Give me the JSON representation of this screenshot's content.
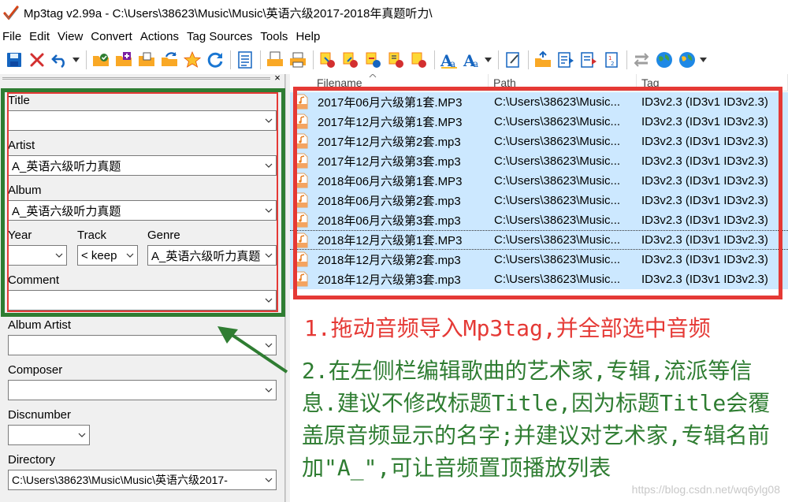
{
  "window": {
    "title": "Mp3tag v2.99a  -  C:\\Users\\38623\\Music\\Music\\英语六级2017-2018年真题听力\\"
  },
  "menu": [
    "File",
    "Edit",
    "View",
    "Convert",
    "Actions",
    "Tag Sources",
    "Tools",
    "Help"
  ],
  "toolbar": {
    "icons": [
      "save-icon",
      "remove-tag-icon",
      "undo-icon",
      "change-directory-icon",
      "add-directory-icon",
      "open-folder-icon",
      "refresh-folder-icon",
      "favorite-star-icon",
      "reload-icon",
      "extended-tags-icon",
      "export-icon",
      "print-icon",
      "tag-to-filename-icon",
      "filename-to-tag-icon",
      "tag-to-tag-icon",
      "text-file-to-tag-icon",
      "tag-from-list-icon",
      "case-conversion-icon",
      "text-format-icon",
      "edit-icon",
      "import-icon",
      "playlist-icon",
      "playlist-alt-icon",
      "numbering-icon",
      "web-source-icon",
      "globe-icon",
      "globe-alt-icon"
    ],
    "colors": {
      "blue": "#1565c0",
      "yellow": "#f9a825",
      "red": "#d32f2f",
      "green": "#2e7d32"
    }
  },
  "left_panel": {
    "fields": {
      "title": {
        "label": "Title",
        "value": ""
      },
      "artist": {
        "label": "Artist",
        "value": "A_英语六级听力真题"
      },
      "album": {
        "label": "Album",
        "value": "A_英语六级听力真题"
      },
      "year": {
        "label": "Year",
        "value": ""
      },
      "track": {
        "label": "Track",
        "value": "< keep"
      },
      "genre": {
        "label": "Genre",
        "value": "A_英语六级听力真题"
      },
      "comment": {
        "label": "Comment",
        "value": ""
      },
      "album_artist": {
        "label": "Album Artist",
        "value": ""
      },
      "composer": {
        "label": "Composer",
        "value": ""
      },
      "discnumber": {
        "label": "Discnumber",
        "value": ""
      },
      "directory": {
        "label": "Directory",
        "value": "C:\\Users\\38623\\Music\\Music\\英语六级2017-"
      }
    },
    "highlight_colors": {
      "green": "#2f7d32",
      "red": "#e53935"
    }
  },
  "file_list": {
    "columns": [
      "Filename",
      "Path",
      "Tag"
    ],
    "rows": [
      {
        "filename": "2017年06月六级第1套.MP3",
        "path": "C:\\Users\\38623\\Music...",
        "tag": "ID3v2.3 (ID3v1 ID3v2.3)"
      },
      {
        "filename": "2017年12月六级第1套.MP3",
        "path": "C:\\Users\\38623\\Music...",
        "tag": "ID3v2.3 (ID3v1 ID3v2.3)"
      },
      {
        "filename": "2017年12月六级第2套.mp3",
        "path": "C:\\Users\\38623\\Music...",
        "tag": "ID3v2.3 (ID3v1 ID3v2.3)"
      },
      {
        "filename": "2017年12月六级第3套.mp3",
        "path": "C:\\Users\\38623\\Music...",
        "tag": "ID3v2.3 (ID3v1 ID3v2.3)"
      },
      {
        "filename": "2018年06月六级第1套.MP3",
        "path": "C:\\Users\\38623\\Music...",
        "tag": "ID3v2.3 (ID3v1 ID3v2.3)"
      },
      {
        "filename": "2018年06月六级第2套.mp3",
        "path": "C:\\Users\\38623\\Music...",
        "tag": "ID3v2.3 (ID3v1 ID3v2.3)"
      },
      {
        "filename": "2018年06月六级第3套.mp3",
        "path": "C:\\Users\\38623\\Music...",
        "tag": "ID3v2.3 (ID3v1 ID3v2.3)"
      },
      {
        "filename": "2018年12月六级第1套.MP3",
        "path": "C:\\Users\\38623\\Music...",
        "tag": "ID3v2.3 (ID3v1 ID3v2.3)"
      },
      {
        "filename": "2018年12月六级第2套.mp3",
        "path": "C:\\Users\\38623\\Music...",
        "tag": "ID3v2.3 (ID3v1 ID3v2.3)"
      },
      {
        "filename": "2018年12月六级第3套.mp3",
        "path": "C:\\Users\\38623\\Music...",
        "tag": "ID3v2.3 (ID3v1 ID3v2.3)"
      }
    ],
    "selection_color": "#cce8ff"
  },
  "annotations": {
    "note1": "1.拖动音频导入Mp3tag,并全部选中音频",
    "note2": "2.在左侧栏编辑歌曲的艺术家,专辑,流派等信息.建议不修改标题Title,因为标题Title会覆盖原音频显示的名字;并建议对艺术家,专辑名前加\"A_\",可让音频置顶播放列表",
    "note1_color": "#e53935",
    "note2_color": "#2f7d32"
  },
  "watermark": "https://blog.csdn.net/wq6ylg08"
}
